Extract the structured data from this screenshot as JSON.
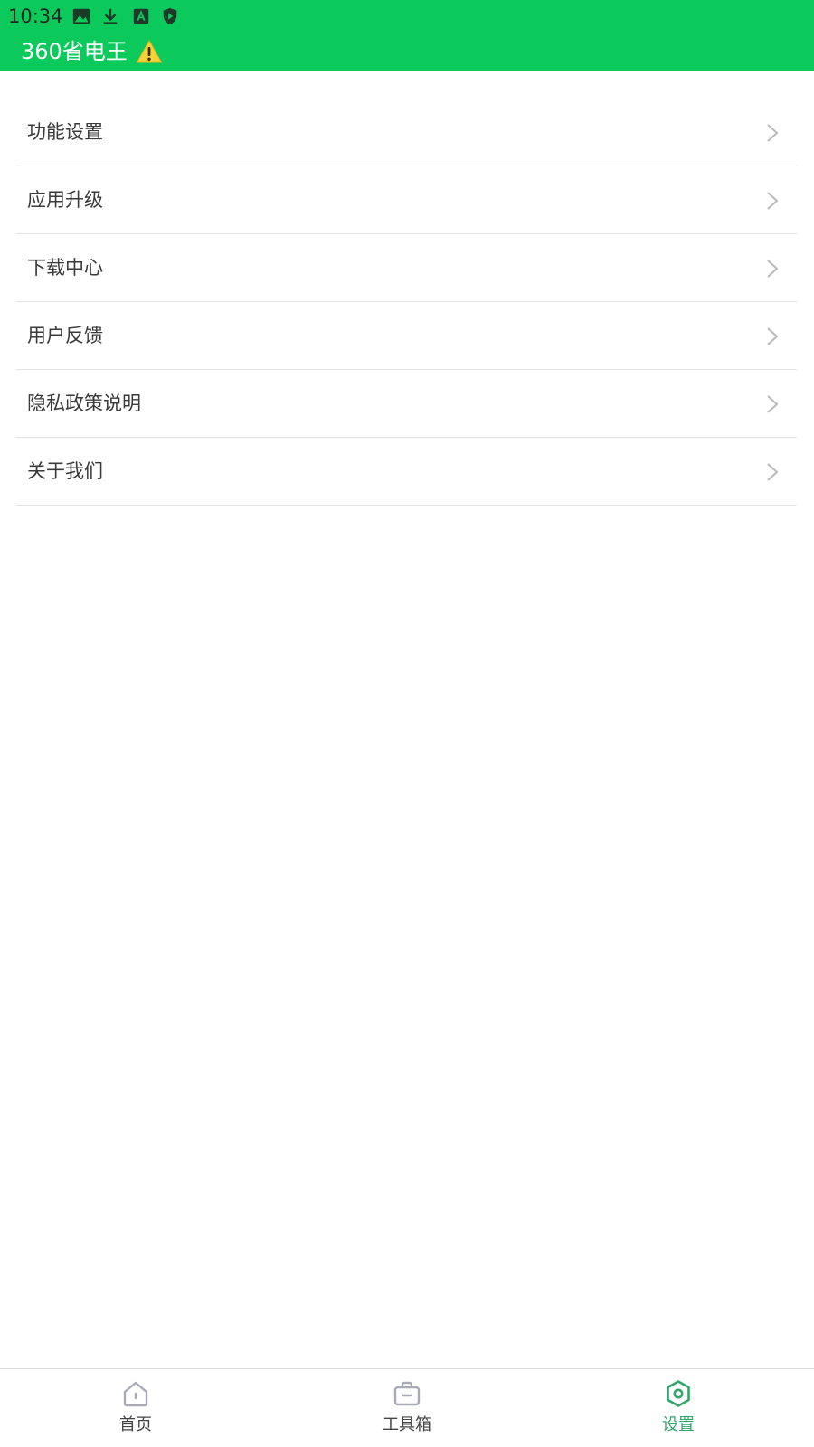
{
  "status_bar": {
    "time": "10:34",
    "icons": [
      "image-icon",
      "download-icon",
      "a-box-icon",
      "shield-play-icon"
    ]
  },
  "header": {
    "app_title": "360省电王",
    "warning_icon": "warning-icon"
  },
  "settings": {
    "items": [
      {
        "label": "功能设置"
      },
      {
        "label": "应用升级"
      },
      {
        "label": "下载中心"
      },
      {
        "label": "用户反馈"
      },
      {
        "label": "隐私政策说明"
      },
      {
        "label": "关于我们"
      }
    ]
  },
  "bottom_nav": {
    "items": [
      {
        "label": "首页",
        "icon": "home-icon",
        "active": false
      },
      {
        "label": "工具箱",
        "icon": "toolbox-icon",
        "active": false
      },
      {
        "label": "设置",
        "icon": "settings-hexagon-icon",
        "active": true
      }
    ]
  },
  "colors": {
    "header_bg": "#0cc95b",
    "active_nav": "#2fa86a",
    "inactive_icon": "#a9aab7"
  }
}
